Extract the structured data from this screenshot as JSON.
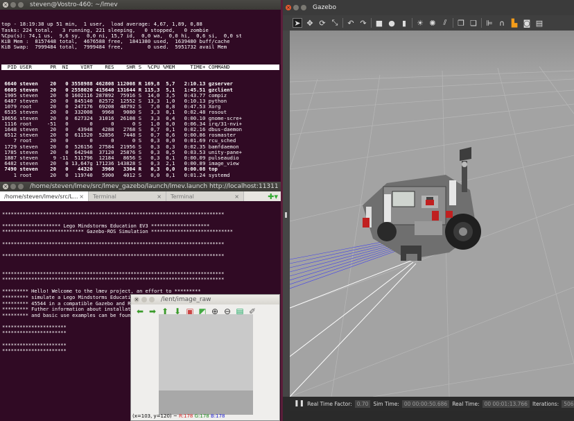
{
  "top": {
    "title": "steven@Vostro-460: ~/lmev",
    "header_lines": [
      "top - 18:19:38 up 51 min,  1 user,  load average: 4,67, 1,89, 0,88",
      "Tasks: 224 total,   3 running, 221 sleeping,   0 stopped,   0 zombie",
      "%Cpu(s): 74,1 us,  9,6 sy,  0,0 ni, 15,7 id,  0,0 wa,  0,0 hi,  0,6 si,  0,0 st",
      "KiB Mem :  8157448 total,  4676588 free,  1841380 used,  1639480 buff/cache",
      "KiB Swap:  7999484 total,  7999484 free,        0 used.  5951732 avail Mem"
    ],
    "columns": "  PID USER      PR  NI    VIRT    RES    SHR S  %CPU %MEM     TIME+ COMMAND     ",
    "rows": [
      {
        "text": " 6640 steven    20   0 3558988 462808 112008 R 169,8  5,7   2:10.13 gzserver",
        "bold": true
      },
      {
        "text": " 6605 steven    20   0 2558020 415640 131644 R 115,3  5,1   1:45.51 gzclient",
        "bold": true
      },
      {
        "text": " 1905 steven    20   0 1602116 287892  75916 S  14,0  3,5   0:43.77 compiz",
        "bold": false
      },
      {
        "text": " 6487 steven    20   0  845140  82572  12552 S  13,3  1,0   0:10.13 python",
        "bold": false
      },
      {
        "text": " 1079 root      20   0  247176  69208  48792 S   7,0  0,8   0:47.53 Xorg",
        "bold": false
      },
      {
        "text": " 6535 steven    20   0  332008   9968   9080 S   3,3  0,1   0:02.48 rosout",
        "bold": false
      },
      {
        "text": "10656 steven    20   0  627324  31016  26108 S   3,3  0,4   0:00.10 gnome-scre+",
        "bold": false
      },
      {
        "text": " 1116 root     -51   0       0      0      0 S   1,0  0,0   0:06.34 irq/31-nvi+",
        "bold": false
      },
      {
        "text": " 1648 steven    20   0   43948   4288   2768 S   0,7  0,1   0:02.16 dbus-daemon",
        "bold": false
      },
      {
        "text": " 6512 steven    20   0  611520  52856   7448 S   0,7  0,6   0:00.86 rosmaster",
        "bold": false
      },
      {
        "text": "    7 root      20   0       0      0      0 S   0,3  0,0   0:01.69 rcu_sched",
        "bold": false
      },
      {
        "text": " 1729 steven    20   0  526156  27584  21956 S   0,3  0,3   0:02.35 bamfdaemon",
        "bold": false
      },
      {
        "text": " 1785 steven    20   0  642948  37120  25876 S   0,3  0,5   0:03.53 unity-pane+",
        "bold": false
      },
      {
        "text": " 1887 steven     9 -11  511796  12184   8656 S   0,3  0,1   0:00.09 pulseaudio",
        "bold": false
      },
      {
        "text": " 6482 steven    20   0 13,647g 171236 143828 S   0,3  2,1   0:00.89 image_view",
        "bold": false
      },
      {
        "text": " 7490 steven    20   0   44320   3960   3304 R   0,3  0,0   0:00.08 top",
        "bold": true
      },
      {
        "text": "    1 root      20   0  119740   5900   4012 S   0,0  0,1   0:01.24 systemd",
        "bold": false
      }
    ]
  },
  "terminal": {
    "title": "/home/steven/lmev/src/lmev_gazebo/launch/lmev.launch http://localhost:11311",
    "tabs": [
      "/home/steven/lmev/src/L...",
      "Terminal",
      "Terminal"
    ],
    "lines": [
      "",
      "****************************************************************************",
      "",
      "******************** Lego Mindstorms Education EV3 ********************",
      "**************************** Gazebo-ROS Simulation ****************************",
      "",
      "****************************************************************************",
      "",
      "****************************************************************************",
      "",
      "",
      "****************************************************************************",
      "****************************************************************************",
      "",
      "********* Hello! Welcome to the lmev project, an effort to *********",
      "********* simulate a Lego Mindstorms Education EV3 Core Set *********",
      "********* 45544 in a compatible Gazebo and ROS environment. *********",
      "********* Futher information about installation, tutorials *********",
      "********* and basic use examples can be found in the user guide. ****",
      "",
      "**********************",
      "**********************",
      "",
      "**********************",
      "**********************"
    ]
  },
  "image_raw": {
    "title": "/lent/image_raw",
    "status_pos": "(x=103, y=120) ~",
    "status_r": "R:178",
    "status_g": "G:178",
    "status_b": "B:178",
    "colors": {
      "r": "#d42020",
      "g": "#1a8a1a",
      "b": "#2020d0"
    }
  },
  "gazebo": {
    "title": "Gazebo",
    "status": {
      "rtf_label": "Real Time Factor:",
      "rtf_value": "0.70",
      "sim_label": "Sim Time:",
      "sim_value": "00 00:00:50.686",
      "real_label": "Real Time:",
      "real_value": "00 00:01:13.766",
      "iter_label": "Iterations:",
      "iter_value": "506"
    }
  }
}
